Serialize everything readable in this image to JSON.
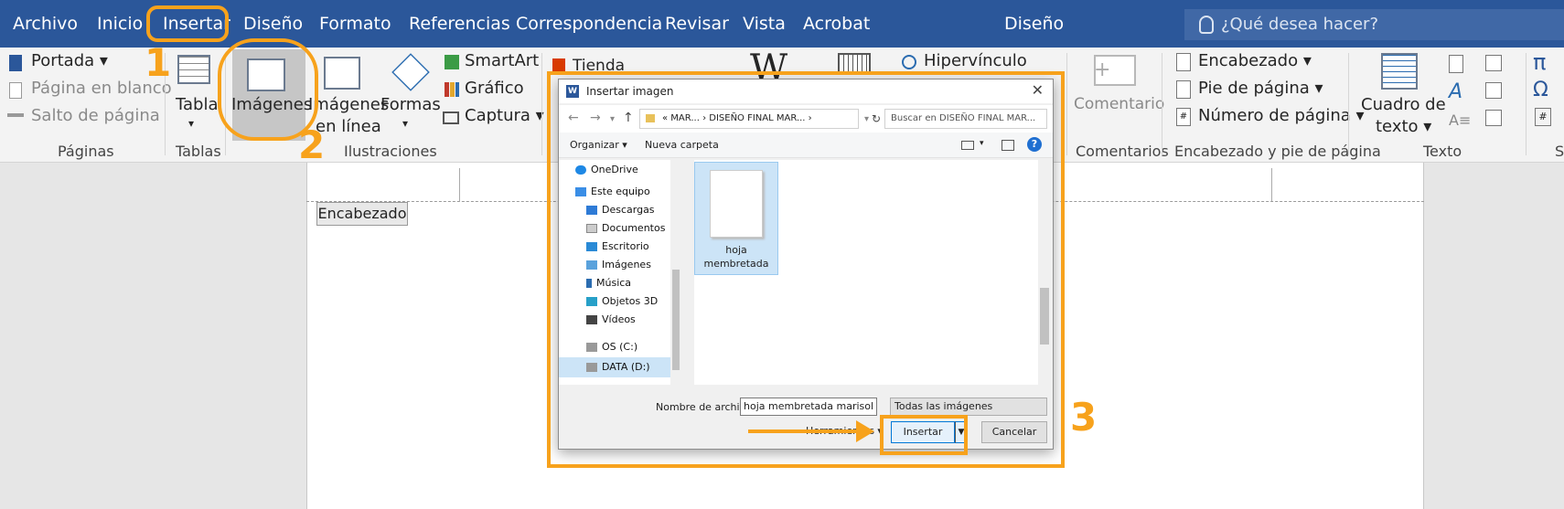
{
  "menubar": {
    "tabs": [
      "Archivo",
      "Inicio",
      "Insertar",
      "Diseño",
      "Formato",
      "Referencias",
      "Correspondencia",
      "Revisar",
      "Vista",
      "Acrobat"
    ],
    "context_title": "Diseño",
    "tell_me_placeholder": "¿Qué desea hacer?"
  },
  "ribbon": {
    "paginas": {
      "portada": "Portada",
      "pagina_blanco": "Página en blanco",
      "salto": "Salto de página",
      "label": "Páginas"
    },
    "tablas": {
      "tabla": "Tabla",
      "label": "Tablas"
    },
    "ilustraciones": {
      "imagenes": "Imágenes",
      "imagenes_linea_1": "Imágenes",
      "imagenes_linea_2": "en línea",
      "formas": "Formas",
      "smartart": "SmartArt",
      "grafico": "Gráfico",
      "captura": "Captura",
      "label": "Ilustraciones"
    },
    "complementos": {
      "tienda": "Tienda"
    },
    "vinculos": {
      "hipervinculo": "Hipervínculo"
    },
    "comentarios": {
      "comentario": "Comentario",
      "label": "Comentarios"
    },
    "encabezado": {
      "encabezado": "Encabezado",
      "pie": "Pie de página",
      "numero": "Número de página",
      "label": "Encabezado y pie de página"
    },
    "texto": {
      "cuadro_1": "Cuadro de",
      "cuadro_2": "texto",
      "label": "Texto"
    },
    "simbolos": {
      "label": "S"
    }
  },
  "document": {
    "header_tag": "Encabezado"
  },
  "dialog": {
    "title": "Insertar imagen",
    "address": "« MAR... › DISEÑO FINAL MAR... ›",
    "search_placeholder": "Buscar en DISEÑO FINAL MAR...",
    "organize": "Organizar ▾",
    "new_folder": "Nueva carpeta",
    "nav": [
      "OneDrive",
      "Este equipo",
      "Descargas",
      "Documentos",
      "Escritorio",
      "Imágenes",
      "Música",
      "Objetos 3D",
      "Vídeos",
      "OS (C:)",
      "DATA (D:)"
    ],
    "file": {
      "line1": "hoja",
      "line2": "membretada"
    },
    "filename_label": "Nombre de archivo:",
    "filename_value": "hoja membretada marisol sin",
    "filter": "Todas las imágenes",
    "tools": "Herramientas",
    "insert": "Insertar",
    "cancel": "Cancelar"
  },
  "annotations": {
    "n1": "1",
    "n2": "2",
    "n3": "3"
  },
  "colors": {
    "accent_orange": "#f7a21c",
    "word_blue": "#2b579a"
  }
}
